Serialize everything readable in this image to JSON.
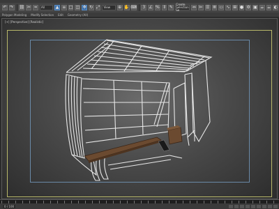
{
  "toolbar": {
    "selection_filter": "All",
    "view_dropdown": "View",
    "selection_set": "Create Selection Se"
  },
  "ribbon": {
    "items": [
      "Modeling",
      "Freeform",
      "Selection",
      "Object Paint",
      "Populate"
    ],
    "sub_items": [
      "Polygon Modeling",
      "Modify Selection",
      "Edit",
      "Geometry (All)"
    ]
  },
  "viewport": {
    "label": "[+] [Perspective] [Realistic]"
  },
  "timeline": {
    "frame_counter": "0 / 100"
  },
  "colors": {
    "viewport_bg": "#4a4a4a",
    "wireframe": "#e8e8e8",
    "bench_wood": "#6b4a30",
    "safe_frame_outer": "#b9b96a",
    "safe_frame_inner": "#6a8aa8"
  }
}
